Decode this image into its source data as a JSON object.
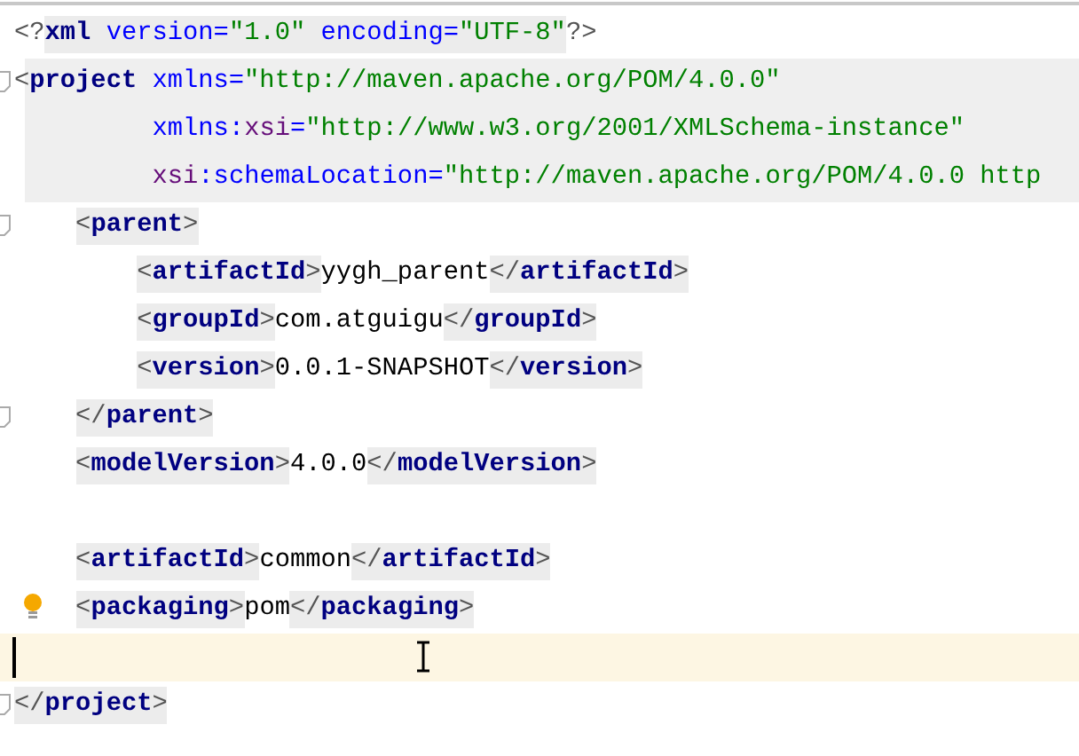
{
  "editor": {
    "lines": [
      {
        "kind": "plain",
        "tokens": [
          {
            "kind": "pi",
            "text": "<?",
            "shaded": false
          },
          {
            "kind": "tag",
            "text": "xml",
            "shaded": true
          },
          {
            "kind": "attr",
            "text": " version=",
            "shaded": true
          },
          {
            "kind": "value",
            "text": "\"1.0\"",
            "shaded": true
          },
          {
            "kind": "attr",
            "text": " encoding=",
            "shaded": true
          },
          {
            "kind": "value",
            "text": "\"UTF-8\"",
            "shaded": true
          },
          {
            "kind": "pi",
            "text": "?>",
            "shaded": false
          }
        ]
      },
      {
        "kind": "fold",
        "highlighted": true,
        "tokens": [
          {
            "kind": "punct",
            "text": "<"
          },
          {
            "kind": "tag",
            "text": "project"
          },
          {
            "kind": "attr",
            "text": " xmlns="
          },
          {
            "kind": "value",
            "text": "\"http://maven.apache.org/POM/4.0.0\""
          }
        ],
        "attribute_lines": [
          {
            "kind": "plain",
            "highlighted": true,
            "tokens": [
              {
                "kind": "attr",
                "text": "xmlns:"
              },
              {
                "kind": "ns",
                "text": "xsi"
              },
              {
                "kind": "attr",
                "text": "="
              },
              {
                "kind": "value",
                "text": "\"http://www.w3.org/2001/XMLSchema-instance\""
              }
            ]
          },
          {
            "kind": "plain",
            "highlighted": true,
            "tokens": [
              {
                "kind": "ns",
                "text": "xsi"
              },
              {
                "kind": "attr",
                "text": ":schemaLocation="
              },
              {
                "kind": "value",
                "text": "\"http://maven.apache.org/POM/4.0.0 http"
              }
            ]
          }
        ],
        "children": [
          {
            "kind": "fold",
            "tokens": [
              {
                "kind": "punct",
                "text": "<",
                "shaded": true
              },
              {
                "kind": "tag",
                "text": "parent",
                "shaded": true
              },
              {
                "kind": "punct",
                "text": ">",
                "shaded": true
              }
            ],
            "children": [
              {
                "kind": "plain",
                "tokens": [
                  {
                    "kind": "punct",
                    "text": "<",
                    "shaded": true
                  },
                  {
                    "kind": "tag",
                    "text": "artifactId",
                    "shaded": true
                  },
                  {
                    "kind": "punct",
                    "text": ">",
                    "shaded": true
                  },
                  {
                    "kind": "text",
                    "text": "yygh_parent",
                    "shaded": false
                  },
                  {
                    "kind": "punct",
                    "text": "</",
                    "shaded": true
                  },
                  {
                    "kind": "tag",
                    "text": "artifactId",
                    "shaded": true
                  },
                  {
                    "kind": "punct",
                    "text": ">",
                    "shaded": true
                  }
                ]
              },
              {
                "kind": "plain",
                "tokens": [
                  {
                    "kind": "punct",
                    "text": "<",
                    "shaded": true
                  },
                  {
                    "kind": "tag",
                    "text": "groupId",
                    "shaded": true
                  },
                  {
                    "kind": "punct",
                    "text": ">",
                    "shaded": true
                  },
                  {
                    "kind": "text",
                    "text": "com.atguigu",
                    "shaded": false
                  },
                  {
                    "kind": "punct",
                    "text": "</",
                    "shaded": true
                  },
                  {
                    "kind": "tag",
                    "text": "groupId",
                    "shaded": true
                  },
                  {
                    "kind": "punct",
                    "text": ">",
                    "shaded": true
                  }
                ]
              },
              {
                "kind": "plain",
                "tokens": [
                  {
                    "kind": "punct",
                    "text": "<",
                    "shaded": true
                  },
                  {
                    "kind": "tag",
                    "text": "version",
                    "shaded": true
                  },
                  {
                    "kind": "punct",
                    "text": ">",
                    "shaded": true
                  },
                  {
                    "kind": "text",
                    "text": "0.0.1-SNAPSHOT",
                    "shaded": false
                  },
                  {
                    "kind": "punct",
                    "text": "</",
                    "shaded": true
                  },
                  {
                    "kind": "tag",
                    "text": "version",
                    "shaded": true
                  },
                  {
                    "kind": "punct",
                    "text": ">",
                    "shaded": true
                  }
                ]
              }
            ]
          },
          {
            "kind": "fold",
            "tokens": [
              {
                "kind": "punct",
                "text": "</",
                "shaded": true
              },
              {
                "kind": "tag",
                "text": "parent",
                "shaded": true
              },
              {
                "kind": "punct",
                "text": ">",
                "shaded": true
              }
            ]
          },
          {
            "kind": "plain",
            "tokens": [
              {
                "kind": "punct",
                "text": "<",
                "shaded": true
              },
              {
                "kind": "tag",
                "text": "modelVersion",
                "shaded": true
              },
              {
                "kind": "punct",
                "text": ">",
                "shaded": true
              },
              {
                "kind": "text",
                "text": "4.0.0",
                "shaded": false
              },
              {
                "kind": "punct",
                "text": "</",
                "shaded": true
              },
              {
                "kind": "tag",
                "text": "modelVersion",
                "shaded": true
              },
              {
                "kind": "punct",
                "text": ">",
                "shaded": true
              }
            ]
          },
          {
            "kind": "blank"
          },
          {
            "kind": "plain",
            "tokens": [
              {
                "kind": "punct",
                "text": "<",
                "shaded": true
              },
              {
                "kind": "tag",
                "text": "artifactId",
                "shaded": true
              },
              {
                "kind": "punct",
                "text": ">",
                "shaded": true
              },
              {
                "kind": "text",
                "text": "common",
                "shaded": false
              },
              {
                "kind": "punct",
                "text": "</",
                "shaded": true
              },
              {
                "kind": "tag",
                "text": "artifactId",
                "shaded": true
              },
              {
                "kind": "punct",
                "text": ">",
                "shaded": true
              }
            ]
          },
          {
            "kind": "bulb",
            "tokens": [
              {
                "kind": "punct",
                "text": "<",
                "shaded": true
              },
              {
                "kind": "tag",
                "text": "packaging",
                "shaded": true
              },
              {
                "kind": "punct",
                "text": ">",
                "shaded": true
              },
              {
                "kind": "text",
                "text": "pom",
                "shaded": false
              },
              {
                "kind": "punct",
                "text": "</",
                "shaded": true
              },
              {
                "kind": "tag",
                "text": "packaging",
                "shaded": true
              },
              {
                "kind": "punct",
                "text": ">",
                "shaded": true
              }
            ]
          }
        ]
      },
      {
        "kind": "blank",
        "current": true
      },
      {
        "kind": "fold",
        "tokens": [
          {
            "kind": "punct",
            "text": "</",
            "shaded": true
          },
          {
            "kind": "tag",
            "text": "project",
            "shaded": true
          },
          {
            "kind": "punct",
            "text": ">",
            "shaded": true
          }
        ]
      }
    ]
  }
}
